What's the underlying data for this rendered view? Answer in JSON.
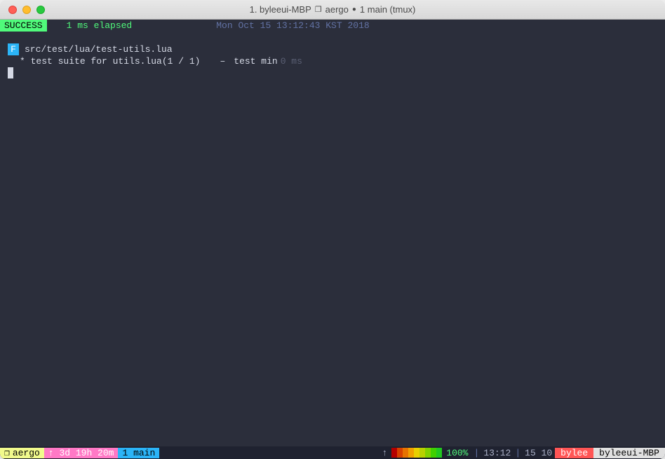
{
  "title": {
    "prefix": "1. byleeui-MBP",
    "folder": "aergo",
    "suffix": "1 main (tmux)"
  },
  "test": {
    "status_badge": "SUCCESS",
    "elapsed": "1 ms elapsed",
    "timestamp": "Mon Oct 15 13:12:43 KST 2018",
    "file_badge": "F",
    "file_path": "src/test/lua/test-utils.lua",
    "suite_text": "* test suite for utils.lua(1 / 1)",
    "dash": "–",
    "test_name": "test min",
    "test_time": "0 ms"
  },
  "tmux": {
    "session_icon": "❐",
    "session": "aergo",
    "uptime": "↑ 3d 19h 20m",
    "window_tab": "1 main",
    "arrow": "↑",
    "battery": "100%",
    "clock": "13:12",
    "date": "15 10",
    "user": "bylee",
    "host": "byleeui-MBP",
    "separator": "|"
  },
  "colors": {
    "blocks": [
      "#b50000",
      "#d64000",
      "#e67300",
      "#f0a000",
      "#e8d000",
      "#b8d000",
      "#80d000",
      "#40d000",
      "#20c820"
    ]
  }
}
